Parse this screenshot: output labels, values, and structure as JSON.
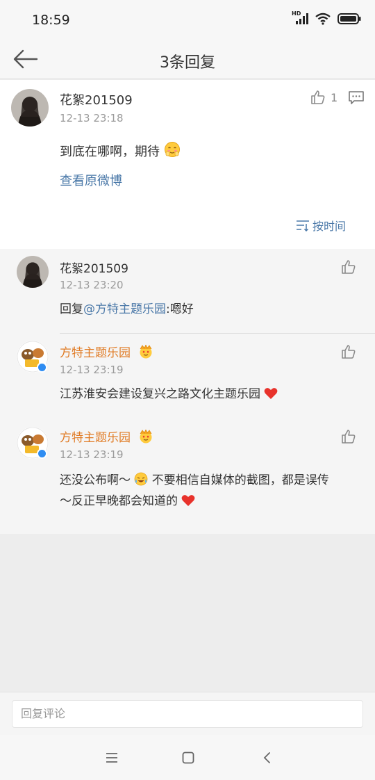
{
  "status_bar": {
    "time": "18:59",
    "network_label": "HD"
  },
  "nav": {
    "title": "3条回复"
  },
  "main_comment": {
    "user": "花絮201509",
    "time": "12-13 23:18",
    "text": "到底在哪啊，期待",
    "emoji": "shy-smile-emoji",
    "view_original": "查看原微博",
    "like_count": "1",
    "sort_label": "按时间"
  },
  "replies": [
    {
      "user": "花絮201509",
      "time": "12-13 23:20",
      "prefix": "回复",
      "mention": "@方特主题乐园",
      "text": ":嗯好",
      "vip": false
    },
    {
      "user": "方特主题乐园",
      "time": "12-13 23:19",
      "text": "江苏淮安会建设复兴之路文化主题乐园",
      "emoji": "heart-emoji",
      "vip": true
    },
    {
      "user": "方特主题乐园",
      "time": "12-13 23:19",
      "text_part1": "还没公布啊～",
      "text_part2": " 不要相信自媒体的截图，都是误传",
      "text_line2": "～反正早晚都会知道的",
      "emoji1": "laugh-cry-emoji",
      "emoji2": "heart-emoji",
      "vip": true
    }
  ],
  "input": {
    "placeholder": "回复评论"
  },
  "colors": {
    "accent": "#4a78a8",
    "vip_name": "#e07a23",
    "verified": "#2f8df2",
    "heart": "#e8322b"
  }
}
